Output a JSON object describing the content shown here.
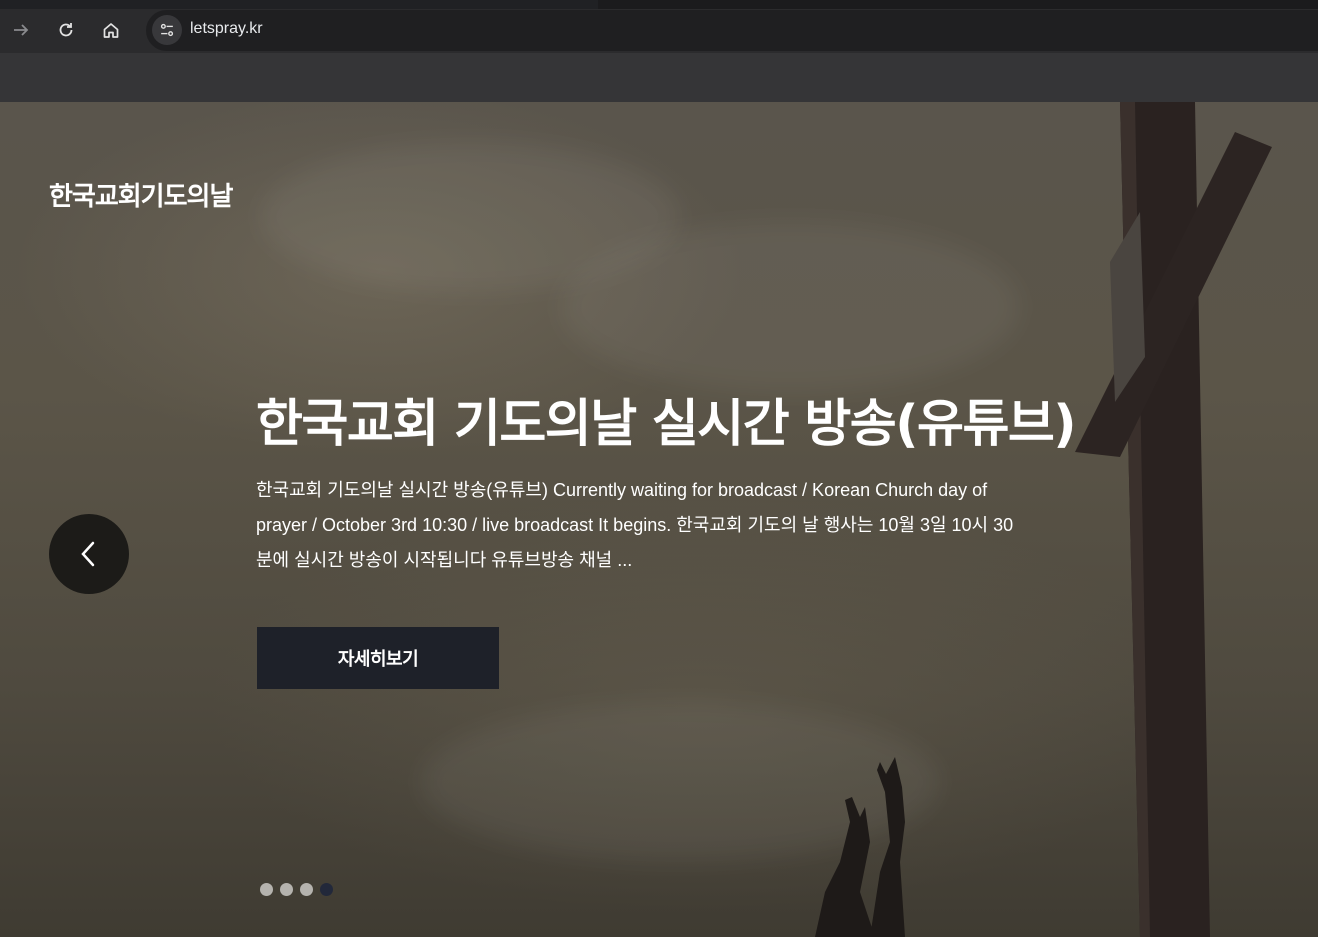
{
  "browser": {
    "url": "letspray.kr"
  },
  "site": {
    "title": "한국교회기도의날"
  },
  "slide": {
    "headline": "한국교회 기도의날 실시간 방송(유튜브)",
    "description": "한국교회 기도의날 실시간 방송(유튜브) Currently waiting for broadcast / Korean Church day of prayer / October 3rd 10:30 / live broadcast  It begins.  한국교회 기도의 날 행사는 10월 3일 10시 30분에  실시간 방송이 시작됩니다 유튜브방송 채널 ...",
    "button_label": "자세히보기"
  },
  "carousel": {
    "slide_count": 4,
    "active_index": 3
  },
  "colors": {
    "button_bg": "#1e2129",
    "active_dot": "#22283a",
    "inactive_dot": "#b5b3ae",
    "prev_button_bg": "#1c1b18"
  }
}
